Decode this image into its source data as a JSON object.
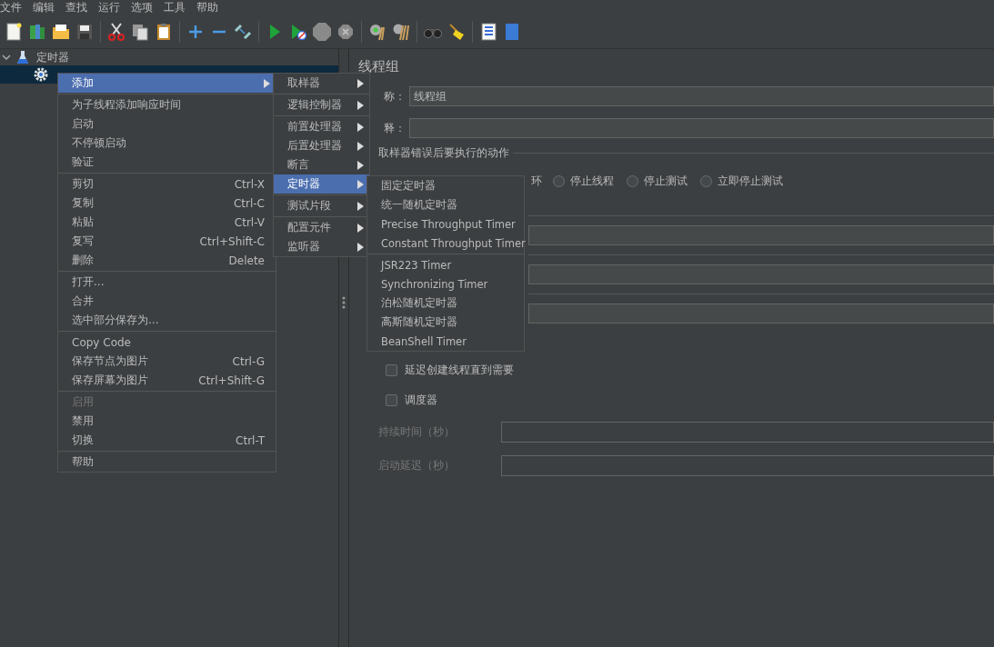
{
  "menu_bar": [
    "文件",
    "编辑",
    "查找",
    "运行",
    "选项",
    "工具",
    "帮助"
  ],
  "tree": [
    {
      "label": "定时器",
      "expanded": true,
      "children": [
        {
          "selected": true
        }
      ]
    }
  ],
  "context_menu": {
    "groups": [
      [
        {
          "label": "添加",
          "submenu": true,
          "selected": true,
          "disabled": false
        }
      ],
      [
        {
          "label": "为子线程添加响应时间",
          "submenu": false,
          "selected": false,
          "disabled": false
        },
        {
          "label": "启动",
          "submenu": false,
          "selected": false,
          "disabled": false
        },
        {
          "label": "不停顿启动",
          "submenu": false,
          "selected": false,
          "disabled": false
        },
        {
          "label": "验证",
          "submenu": false,
          "selected": false,
          "disabled": false
        }
      ],
      [
        {
          "label": "剪切",
          "shortcut": "Ctrl-X",
          "submenu": false,
          "selected": false,
          "disabled": false
        },
        {
          "label": "复制",
          "shortcut": "Ctrl-C",
          "submenu": false,
          "selected": false,
          "disabled": false
        },
        {
          "label": "粘贴",
          "shortcut": "Ctrl-V",
          "submenu": false,
          "selected": false,
          "disabled": false
        },
        {
          "label": "复写",
          "shortcut": "Ctrl+Shift-C",
          "submenu": false,
          "selected": false,
          "disabled": false
        },
        {
          "label": "删除",
          "shortcut": "Delete",
          "submenu": false,
          "selected": false,
          "disabled": false
        }
      ],
      [
        {
          "label": "打开...",
          "submenu": false,
          "selected": false,
          "disabled": false
        },
        {
          "label": "合并",
          "submenu": false,
          "selected": false,
          "disabled": false
        },
        {
          "label": "选中部分保存为...",
          "submenu": false,
          "selected": false,
          "disabled": false
        }
      ],
      [
        {
          "label": "Copy Code",
          "submenu": false,
          "selected": false,
          "disabled": false
        },
        {
          "label": "保存节点为图片",
          "shortcut": "Ctrl-G",
          "submenu": false,
          "selected": false,
          "disabled": false
        },
        {
          "label": "保存屏幕为图片",
          "shortcut": "Ctrl+Shift-G",
          "submenu": false,
          "selected": false,
          "disabled": false
        }
      ],
      [
        {
          "label": "启用",
          "submenu": false,
          "selected": false,
          "disabled": true
        },
        {
          "label": "禁用",
          "submenu": false,
          "selected": false,
          "disabled": false
        },
        {
          "label": "切换",
          "shortcut": "Ctrl-T",
          "submenu": false,
          "selected": false,
          "disabled": false
        }
      ],
      [
        {
          "label": "帮助",
          "submenu": false,
          "selected": false,
          "disabled": false
        }
      ]
    ]
  },
  "add_submenu": {
    "groups": [
      [
        {
          "label": "取样器",
          "submenu": true,
          "selected": false
        }
      ],
      [
        {
          "label": "逻辑控制器",
          "submenu": true,
          "selected": false
        }
      ],
      [
        {
          "label": "前置处理器",
          "submenu": true,
          "selected": false
        },
        {
          "label": "后置处理器",
          "submenu": true,
          "selected": false
        },
        {
          "label": "断言",
          "submenu": true,
          "selected": false
        },
        {
          "label": "定时器",
          "submenu": true,
          "selected": true
        }
      ],
      [
        {
          "label": "测试片段",
          "submenu": true,
          "selected": false
        }
      ],
      [
        {
          "label": "配置元件",
          "submenu": true,
          "selected": false
        },
        {
          "label": "监听器",
          "submenu": true,
          "selected": false
        }
      ]
    ]
  },
  "timer_submenu": {
    "groups": [
      [
        {
          "label": "固定定时器",
          "submenu": false,
          "selected": false
        },
        {
          "label": "统一随机定时器",
          "submenu": false,
          "selected": false
        },
        {
          "label": "Precise Throughput Timer",
          "submenu": false,
          "selected": false
        },
        {
          "label": "Constant Throughput Timer",
          "submenu": false,
          "selected": false
        }
      ],
      [
        {
          "label": "JSR223 Timer",
          "submenu": false,
          "selected": false
        },
        {
          "label": "Synchronizing Timer",
          "submenu": false,
          "selected": false
        },
        {
          "label": "泊松随机定时器",
          "submenu": false,
          "selected": false
        },
        {
          "label": "高斯随机定时器",
          "submenu": false,
          "selected": false
        },
        {
          "label": "BeanShell Timer",
          "submenu": false,
          "selected": false
        }
      ]
    ]
  },
  "panel": {
    "title": "线程组",
    "name_label": "称：",
    "name_value": "线程组",
    "comment_label": "释：",
    "error_action_label": "取样器错误后要执行的动作",
    "radio_fragment": "环",
    "radios": [
      {
        "label": "停止线程",
        "selected": false
      },
      {
        "label": "停止测试",
        "selected": false
      },
      {
        "label": "立即停止测试",
        "selected": false
      }
    ],
    "checkboxes": [
      {
        "label": "延迟创建线程直到需要",
        "checked": false
      },
      {
        "label": "调度器",
        "checked": false
      }
    ],
    "scheduler_fields": [
      {
        "label": "持续时间（秒）",
        "disabled": true
      },
      {
        "label": "启动延迟（秒）",
        "disabled": true
      }
    ]
  }
}
